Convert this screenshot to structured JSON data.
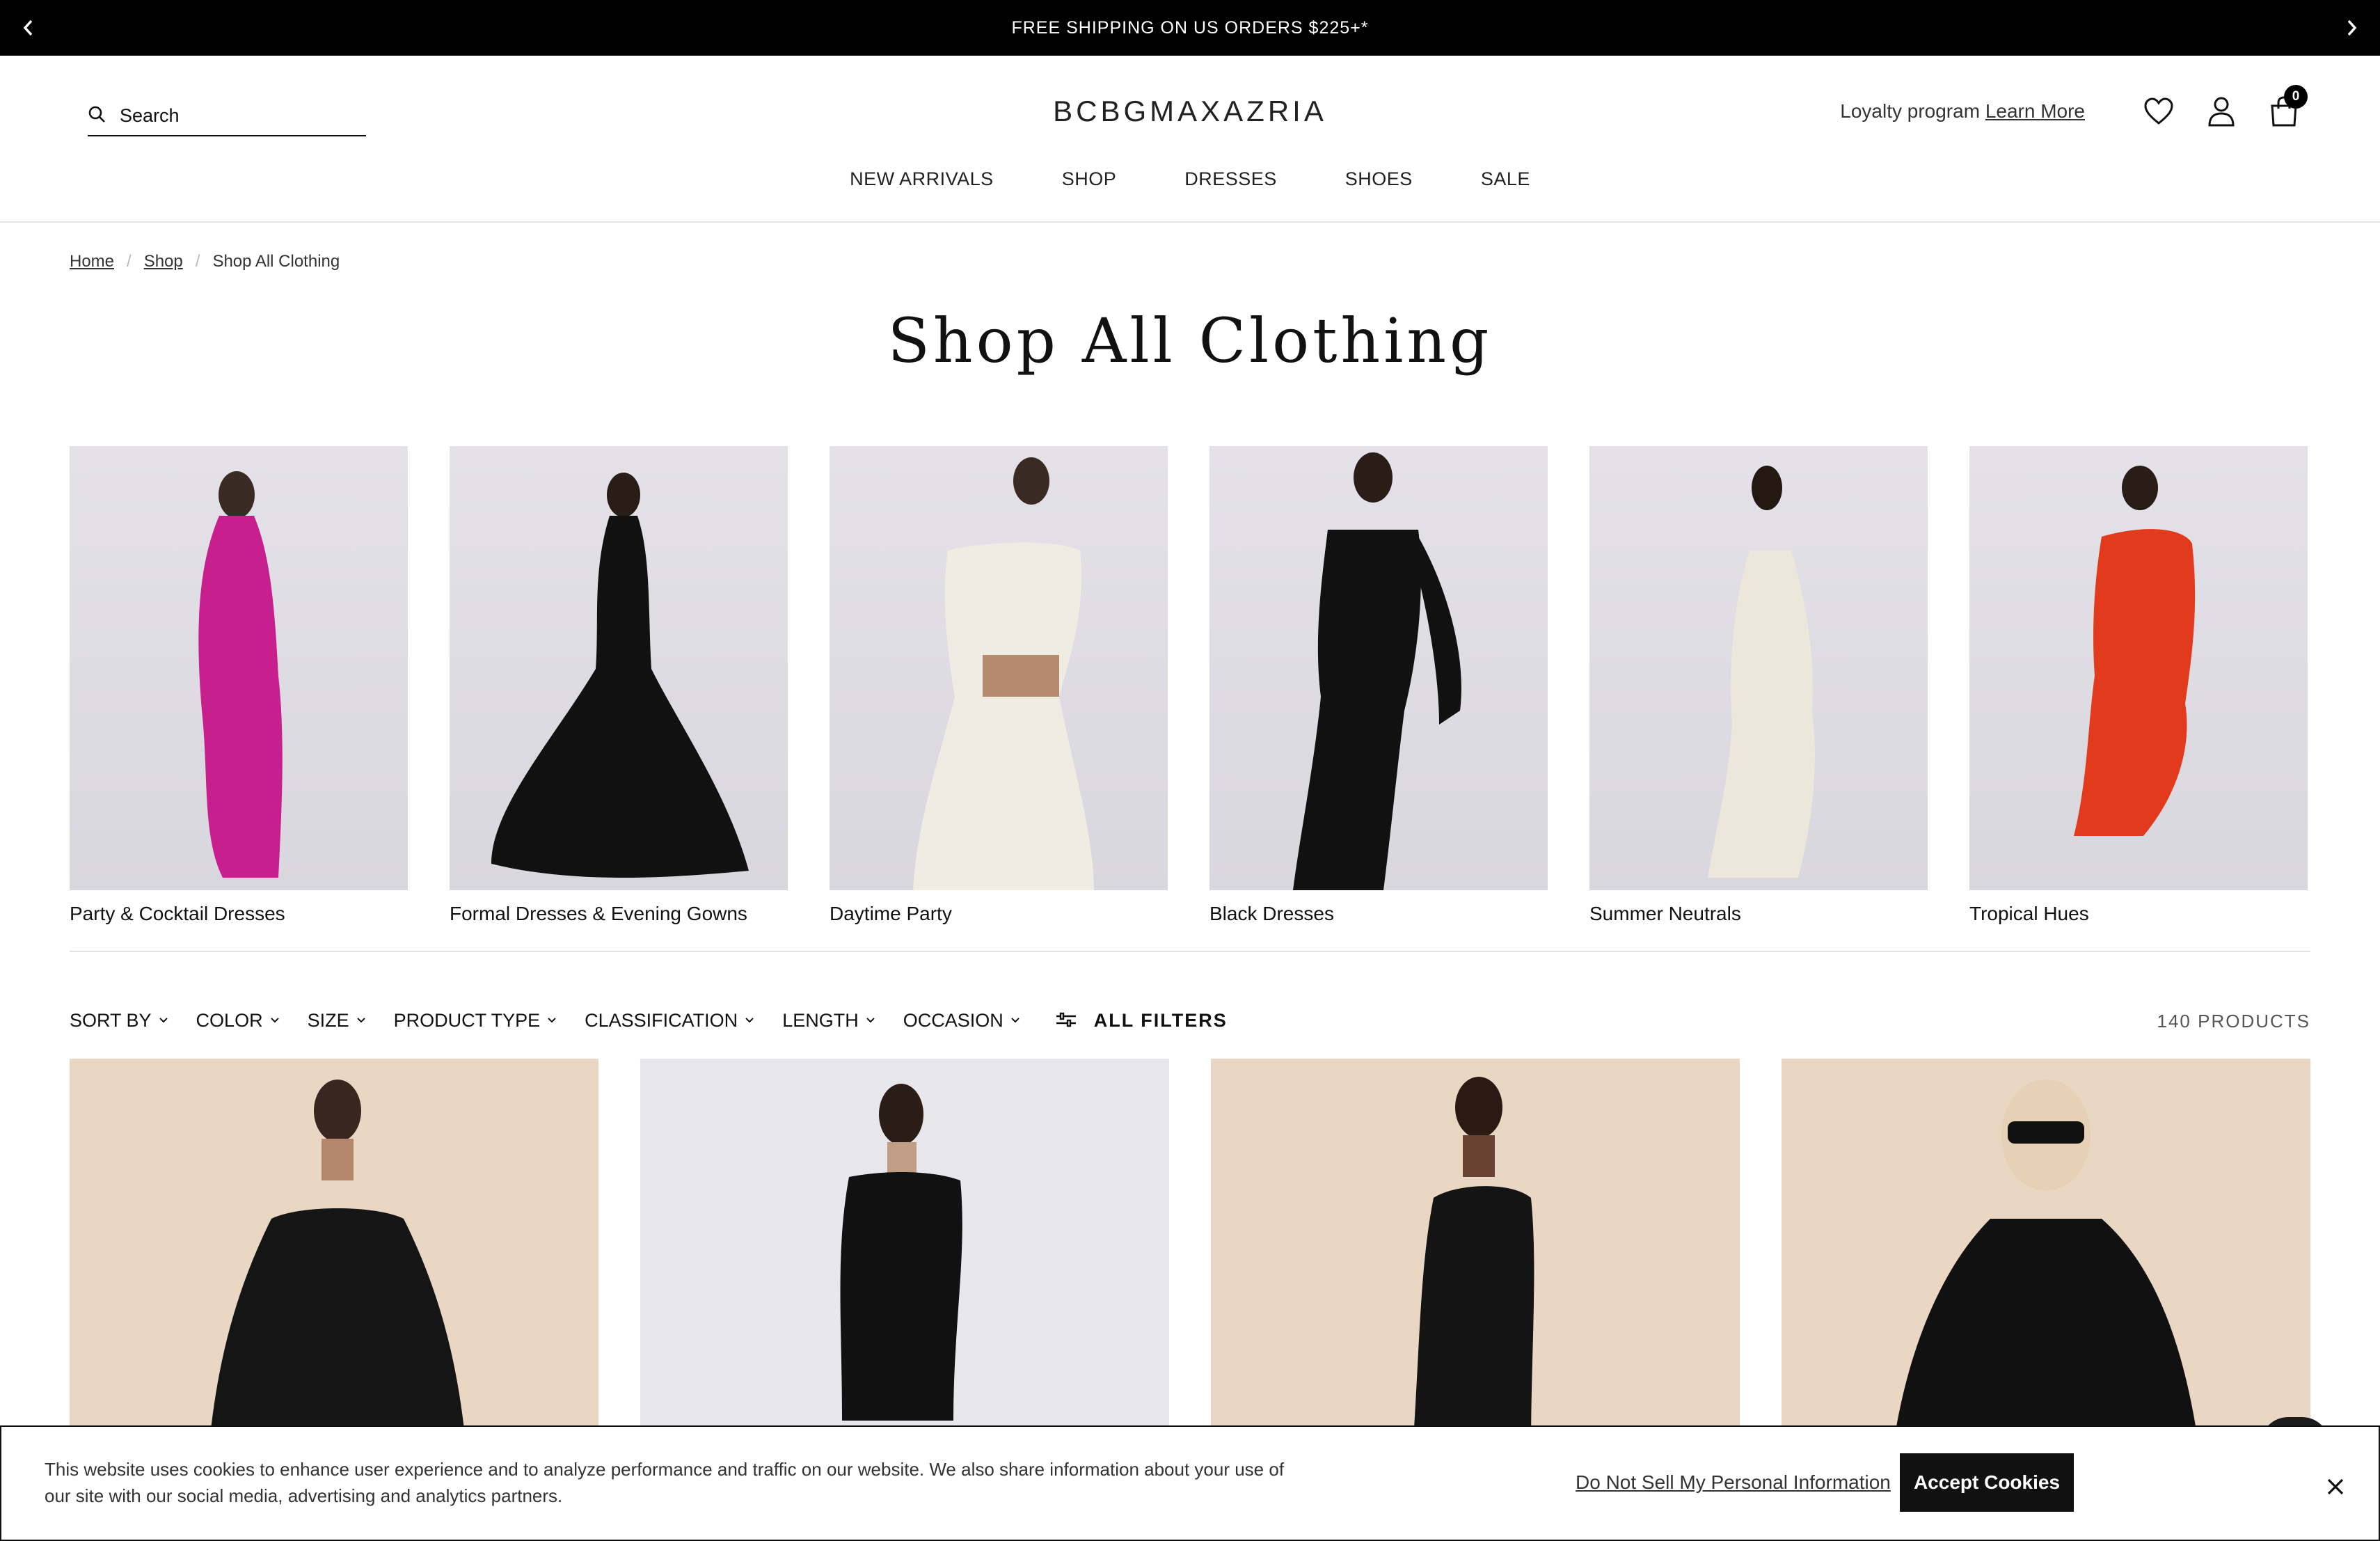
{
  "announcement": {
    "message": "FREE SHIPPING ON US ORDERS $225+*",
    "prev_icon": "chevron-left-icon",
    "next_icon": "chevron-right-icon"
  },
  "header": {
    "search_placeholder": "Search",
    "logo": "BCBGMAXAZRIA",
    "loyalty_text": "Loyalty program",
    "loyalty_link": "Learn More",
    "cart_count": "0",
    "icons": [
      "search-icon",
      "heart-icon",
      "account-icon",
      "cart-icon"
    ]
  },
  "nav": {
    "items": [
      "NEW ARRIVALS",
      "SHOP",
      "DRESSES",
      "SHOES",
      "SALE"
    ]
  },
  "breadcrumb": {
    "items": [
      "Home",
      "Shop",
      "Shop All Clothing"
    ]
  },
  "page_title": "Shop All Clothing",
  "categories": [
    {
      "label": "Party & Cocktail Dresses",
      "dress_color": "#c81f8e"
    },
    {
      "label": "Formal Dresses & Evening Gowns",
      "dress_color": "#111111"
    },
    {
      "label": "Daytime Party",
      "dress_color": "#efece4"
    },
    {
      "label": "Black Dresses",
      "dress_color": "#111111"
    },
    {
      "label": "Summer Neutrals",
      "dress_color": "#ece7da"
    },
    {
      "label": "Tropical Hues",
      "dress_color": "#e23a1c"
    }
  ],
  "filters": {
    "items": [
      "SORT BY",
      "COLOR",
      "SIZE",
      "PRODUCT TYPE",
      "CLASSIFICATION",
      "LENGTH",
      "OCCASION"
    ],
    "all_filters": "ALL FILTERS",
    "product_count": "140 PRODUCTS"
  },
  "products": [
    {
      "background": "beige"
    },
    {
      "background": "grey"
    },
    {
      "background": "beige"
    },
    {
      "background": "beige"
    }
  ],
  "cookie": {
    "text": "This website uses cookies to enhance user experience and to analyze performance and traffic on our website. We also share information about your use of our site with our social media, advertising and analytics partners.",
    "do_not_sell": "Do Not Sell My Personal Information",
    "accept": "Accept Cookies"
  },
  "colors": {
    "announcement_bg": "#000000",
    "text": "#111111",
    "beige": "#e9d7c4",
    "tile_bg": "#e0dee4"
  }
}
